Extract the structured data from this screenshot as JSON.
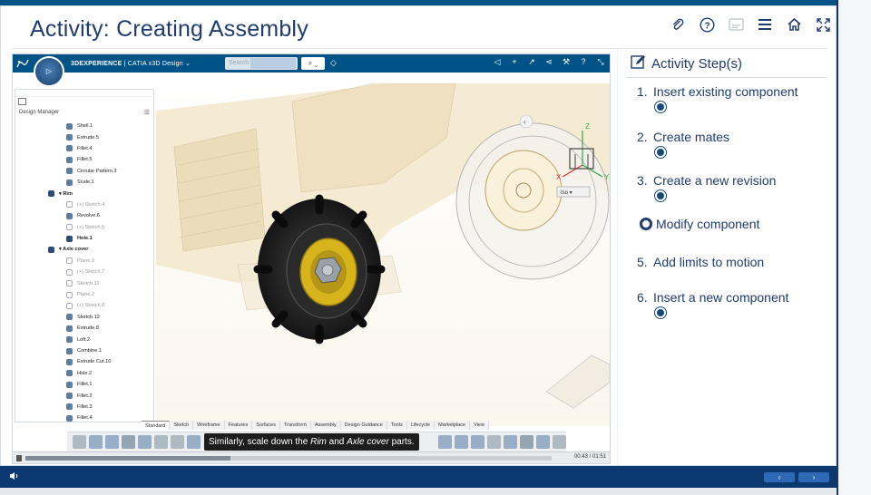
{
  "header": {
    "title": "Activity: Creating Assembly",
    "icons": [
      "paperclip-icon",
      "help-icon",
      "transcript-icon",
      "menu-icon",
      "home-icon",
      "fullscreen-icon"
    ]
  },
  "app": {
    "brand_bold": "3DEXPERIENCE",
    "brand_rest": " | CATIA  x3D Design ⌄",
    "search_placeholder": "Search",
    "design_manager_label": "Design Manager",
    "tree_items": [
      {
        "label": "Shell.1",
        "state": "on"
      },
      {
        "label": "Extrude.5",
        "state": "on"
      },
      {
        "label": "Fillet.4",
        "state": "on"
      },
      {
        "label": "Fillet.5",
        "state": "on"
      },
      {
        "label": "Circular Pattern.3",
        "state": "on"
      },
      {
        "label": "Scale.1",
        "state": "on"
      },
      {
        "label": "▾ Rim",
        "state": "bold"
      },
      {
        "label": "(+) Sketch.4",
        "state": "off"
      },
      {
        "label": "Revolve.6",
        "state": "on"
      },
      {
        "label": "(+) Sketch.5",
        "state": "off"
      },
      {
        "label": "Hole.1",
        "state": "bold"
      },
      {
        "label": "▾ Axle cover",
        "state": "bold"
      },
      {
        "label": "Plane.3",
        "state": "off"
      },
      {
        "label": "(+) Sketch.7",
        "state": "off"
      },
      {
        "label": "Sketch.11",
        "state": "off"
      },
      {
        "label": "Plane.2",
        "state": "off"
      },
      {
        "label": "(+) Sketch.8",
        "state": "off"
      },
      {
        "label": "Sketch.12",
        "state": "on"
      },
      {
        "label": "Extrude.8",
        "state": "on"
      },
      {
        "label": "Loft.2",
        "state": "on"
      },
      {
        "label": "Combine.1",
        "state": "on"
      },
      {
        "label": "Extrude Cut.10",
        "state": "on"
      },
      {
        "label": "Hole.2",
        "state": "on"
      },
      {
        "label": "Fillet.1",
        "state": "on"
      },
      {
        "label": "Fillet.2",
        "state": "on"
      },
      {
        "label": "Fillet.3",
        "state": "on"
      },
      {
        "label": "Fillet.4",
        "state": "on"
      }
    ],
    "tabs": [
      "Standard",
      "Sketch",
      "Wireframe",
      "Features",
      "Surfaces",
      "Transform",
      "Assembly",
      "Design Guidance",
      "Tools",
      "Lifecycle",
      "Marketplace",
      "View"
    ],
    "active_tab": "Standard",
    "view_dropdown": "Iso ▾",
    "caption_pre": "Similarly, scale down the ",
    "caption_em1": "Rim",
    "caption_mid": " and ",
    "caption_em2": "Axle cover",
    "caption_post": " parts.",
    "time": "00:43 / 01:51",
    "progress_fraction": 0.39,
    "axis": {
      "z": "Z",
      "x": "X",
      "y": "Y"
    }
  },
  "steps": {
    "heading": "Activity Step(s)",
    "items": [
      {
        "num": "1.",
        "label": "Insert existing component",
        "done": true,
        "current": false
      },
      {
        "num": "2.",
        "label": "Create mates",
        "done": true,
        "current": false
      },
      {
        "num": "3.",
        "label": "Create a new revision",
        "done": true,
        "current": false
      },
      {
        "num": "",
        "label": "Modify component",
        "done": false,
        "current": true
      },
      {
        "num": "5.",
        "label": "Add limits to motion",
        "done": false,
        "current": false
      },
      {
        "num": "6.",
        "label": "Insert a new component",
        "done": true,
        "current": false
      }
    ]
  },
  "footer": {
    "prev": "‹",
    "next": "›"
  },
  "colors": {
    "navy": "#1f3c70",
    "appbar": "#005386",
    "footer": "#0c3a70",
    "rim_yellow": "#d8b41c"
  }
}
